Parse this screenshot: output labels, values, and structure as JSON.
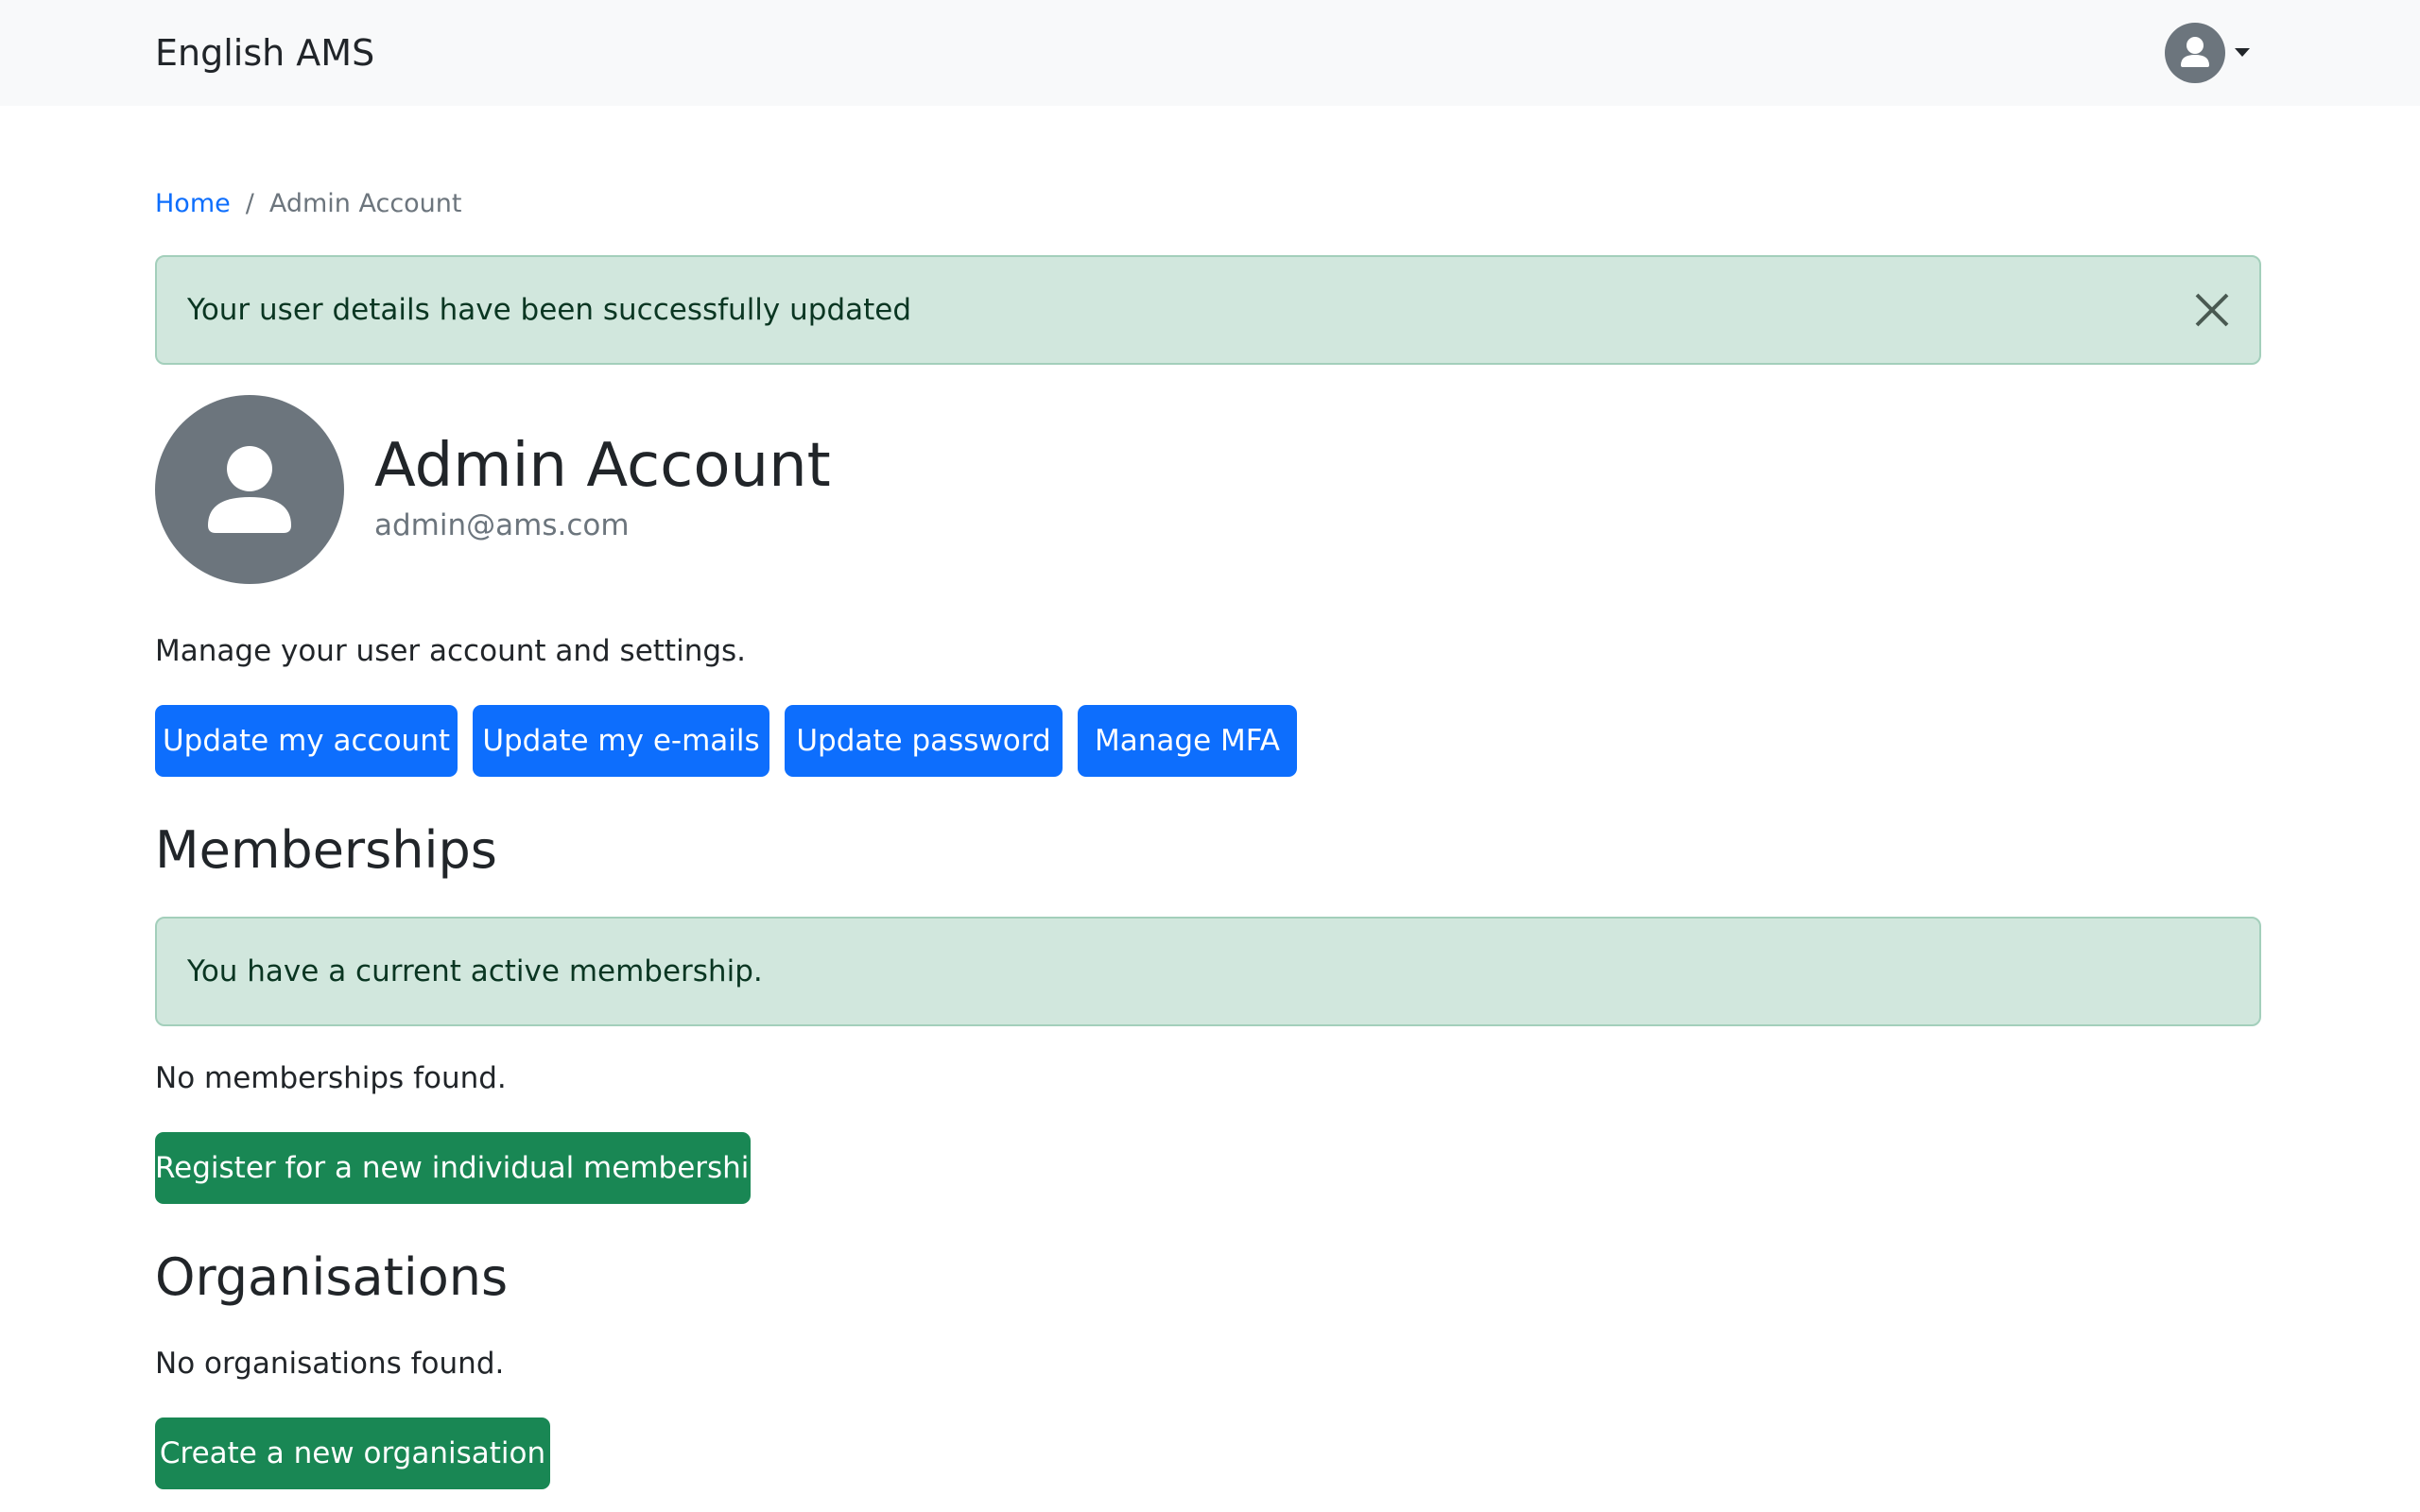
{
  "navbar": {
    "brand": "English AMS",
    "user_icon": "user-avatar-icon",
    "caret_icon": "caret-down-icon"
  },
  "breadcrumb": {
    "home": "Home",
    "separator": "/",
    "current": "Admin Account"
  },
  "alerts": {
    "update_success": "Your user details have been successfully updated",
    "close_icon": "close-icon",
    "membership_active": "You have a current active membership."
  },
  "profile": {
    "name": "Admin Account",
    "email": "admin@ams.com",
    "avatar_icon": "person-icon"
  },
  "account": {
    "description": "Manage your user account and settings.",
    "buttons": {
      "update_account": "Update my account",
      "update_emails": "Update my e-mails",
      "update_password": "Update password",
      "manage_mfa": "Manage MFA"
    }
  },
  "memberships": {
    "title": "Memberships",
    "empty": "No memberships found.",
    "register_button": "Register for a new individual membership"
  },
  "organisations": {
    "title": "Organisations",
    "empty": "No organisations found.",
    "create_button": "Create a new organisation"
  },
  "colors": {
    "primary": "#0d6efd",
    "success": "#198754",
    "alert_success_bg": "#d1e7dd",
    "alert_success_border": "#a3cfbb",
    "avatar_bg": "#6c757d",
    "navbar_bg": "#f8f9fa"
  }
}
